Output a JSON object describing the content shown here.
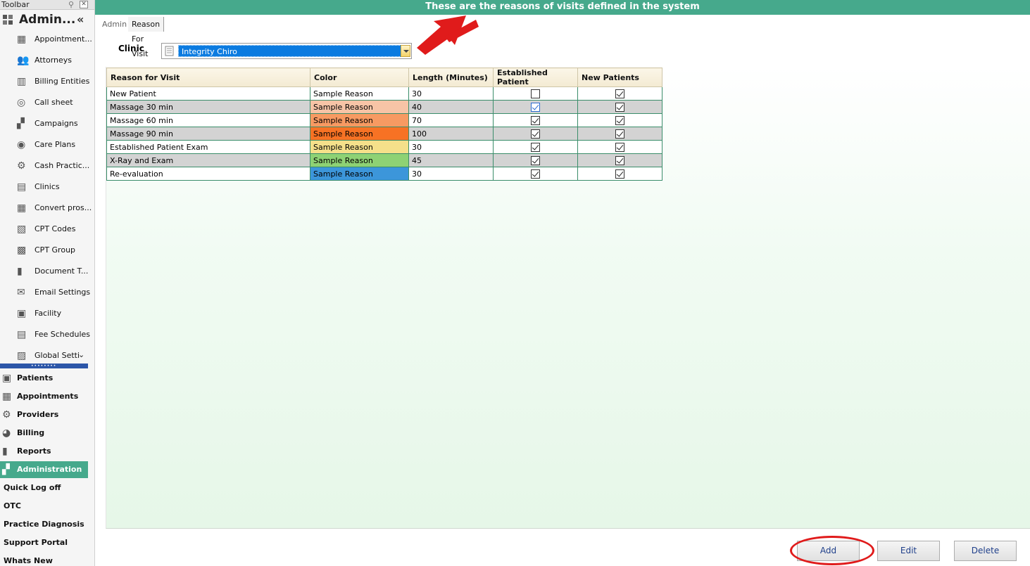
{
  "toolbar": {
    "title": "Toolbar",
    "pin_icon": "pin-icon",
    "close_icon": "close-icon"
  },
  "sidebar": {
    "title": "Admin...",
    "collapse": "«",
    "items": [
      {
        "label": "Appointment...",
        "icon": "appointment-icon"
      },
      {
        "label": "Attorneys",
        "icon": "people-icon"
      },
      {
        "label": "Billing Entities",
        "icon": "billing-entities-icon"
      },
      {
        "label": "Call sheet",
        "icon": "call-sheet-icon"
      },
      {
        "label": "Campaigns",
        "icon": "campaigns-icon"
      },
      {
        "label": "Care Plans",
        "icon": "person-icon"
      },
      {
        "label": "Cash Practic...",
        "icon": "gear-icon"
      },
      {
        "label": "Clinics",
        "icon": "clinics-icon"
      },
      {
        "label": "Convert pros...",
        "icon": "building-icon"
      },
      {
        "label": "CPT Codes",
        "icon": "cpt-codes-icon"
      },
      {
        "label": "CPT Group",
        "icon": "cpt-group-icon"
      },
      {
        "label": "Document T...",
        "icon": "chart-icon"
      },
      {
        "label": "Email Settings",
        "icon": "email-settings-icon"
      },
      {
        "label": "Facility",
        "icon": "facility-icon"
      },
      {
        "label": "Fee Schedules",
        "icon": "fee-schedules-icon"
      },
      {
        "label": "Global Setti",
        "icon": "global-settings-icon"
      }
    ],
    "scroll_chevron": "⌄"
  },
  "nav": {
    "items": [
      {
        "label": "Patients",
        "icon": "patients-icon"
      },
      {
        "label": "Appointments",
        "icon": "appointments-icon"
      },
      {
        "label": "Providers",
        "icon": "gear-icon"
      },
      {
        "label": "Billing",
        "icon": "billing-icon"
      },
      {
        "label": "Reports",
        "icon": "reports-icon"
      },
      {
        "label": "Administration",
        "icon": "administration-icon",
        "active": true
      }
    ],
    "links": [
      "Quick Log off",
      "OTC",
      "Practice Diagnosis",
      "Support Portal",
      "Whats New"
    ]
  },
  "header": {
    "banner": "These are the reasons of visits defined in the system"
  },
  "tabs": [
    "Admin",
    "Reason For Visit"
  ],
  "clinic": {
    "label": "Clinic",
    "value": "Integrity Chiro"
  },
  "grid": {
    "columns": [
      "Reason for Visit",
      "Color",
      "Length (Minutes)",
      "Established Patient",
      "New Patients"
    ],
    "rows": [
      {
        "reason": "New Patient",
        "color_label": "Sample Reason",
        "color": "#ffffff",
        "length": "30",
        "established": false,
        "new": true
      },
      {
        "reason": "Massage 30 min",
        "color_label": "Sample Reason",
        "color": "#f7c4a6",
        "length": "40",
        "established": true,
        "new": true
      },
      {
        "reason": "Massage 60 min",
        "color_label": "Sample Reason",
        "color": "#f79a62",
        "length": "70",
        "established": true,
        "new": true
      },
      {
        "reason": "Massage 90 min",
        "color_label": "Sample Reason",
        "color": "#f77224",
        "length": "100",
        "established": true,
        "new": true
      },
      {
        "reason": "Established Patient Exam",
        "color_label": "Sample Reason",
        "color": "#f5e08a",
        "length": "30",
        "established": true,
        "new": true
      },
      {
        "reason": "X-Ray and Exam",
        "color_label": "Sample Reason",
        "color": "#8ed274",
        "length": "45",
        "established": true,
        "new": true
      },
      {
        "reason": "Re-evaluation",
        "color_label": "Sample Reason",
        "color": "#3c96da",
        "length": "30",
        "established": true,
        "new": true
      }
    ]
  },
  "buttons": {
    "add": "Add",
    "edit": "Edit",
    "delete": "Delete"
  },
  "colors": {
    "accent": "#46a98c",
    "splitter": "#2c56a8",
    "annotation": "#e01b1b"
  }
}
